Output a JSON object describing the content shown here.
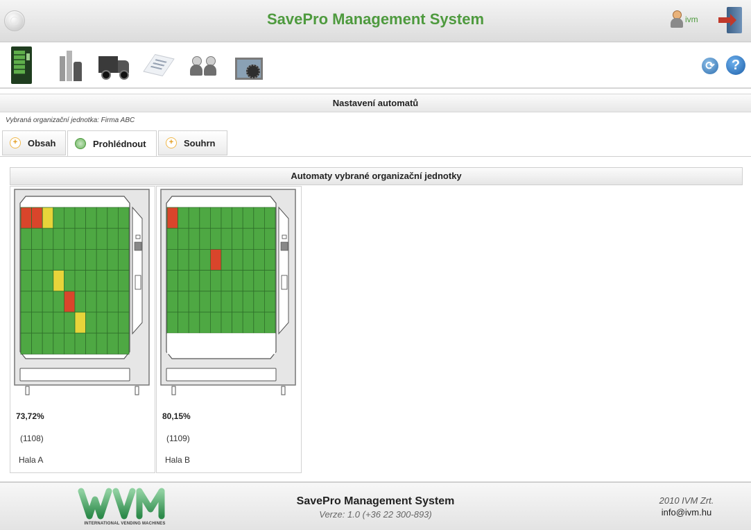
{
  "header": {
    "title": "SavePro Management System",
    "user_name": "ivm",
    "icons": [
      "window-button-icon",
      "user-icon",
      "logout-door-icon"
    ]
  },
  "toolbar": {
    "items": [
      {
        "name": "vending-machine-icon"
      },
      {
        "name": "facility-icon"
      },
      {
        "name": "delivery-truck-icon"
      },
      {
        "name": "document-list-icon"
      },
      {
        "name": "users-icon"
      },
      {
        "name": "screen-settings-icon"
      }
    ],
    "refresh_icon": "refresh-icon",
    "help_label": "?"
  },
  "section": {
    "title": "Nastavení automatů"
  },
  "org_unit": {
    "label": "Vybraná organizační jednotka: Firma ABC"
  },
  "tabs": [
    {
      "label": "Obsah",
      "icon": "+",
      "active": false
    },
    {
      "label": "Prohlédnout",
      "icon": "",
      "active": true
    },
    {
      "label": "Souhrn",
      "icon": "+",
      "active": false
    }
  ],
  "panel": {
    "title": "Automaty vybrané organizační jednotky"
  },
  "machines": [
    {
      "fill": "73,72%",
      "id": "(1108)",
      "location": "Hala A",
      "grid": [
        "RRYGGGGGGG",
        "GGGGGGGGGG",
        "GGGGGGGGGG",
        "GGGYGGGGGG",
        "GGGGRGGGGG",
        "GGGGGYGGGG",
        "GGGGGGGGGG"
      ]
    },
    {
      "fill": "80,15%",
      "id": "(1109)",
      "location": "Hala B",
      "grid": [
        "RGGGGGGGGG",
        "GGGGGGGGGG",
        "GGGGRGGGGG",
        "GGGGGGGGGG",
        "GGGGGGGGGG",
        "GGGGGGGGGG",
        "WWWWWWWWWW"
      ]
    }
  ],
  "colors": {
    "accent": "#4e9a3e",
    "cell_ok": "#4ea843",
    "cell_low": "#e8d43a",
    "cell_empty": "#d9452b"
  },
  "footer": {
    "logo_text": "IVM",
    "logo_subtitle": "INTERNATIONAL VENDING MACHINES",
    "title": "SavePro Management System",
    "version": "Verze: 1.0 (+36 22 300-893)",
    "company": "2010 IVM Zrt.",
    "email": "info@ivm.hu"
  }
}
